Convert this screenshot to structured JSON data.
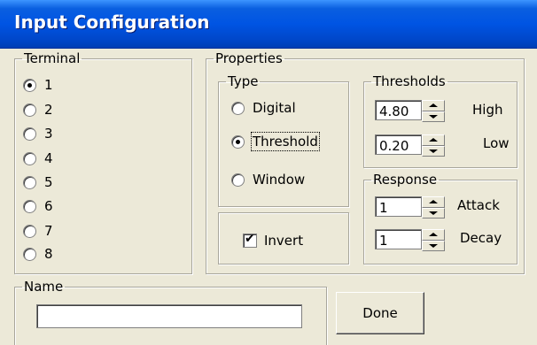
{
  "window": {
    "title": "Input Configuration"
  },
  "terminal": {
    "legend": "Terminal",
    "options": [
      "1",
      "2",
      "3",
      "4",
      "5",
      "6",
      "7",
      "8"
    ],
    "selected": "1"
  },
  "properties": {
    "legend": "Properties",
    "type": {
      "legend": "Type",
      "options": [
        "Digital",
        "Threshold",
        "Window"
      ],
      "selected": "Threshold"
    },
    "invert": {
      "label": "Invert",
      "checked": true
    },
    "thresholds": {
      "legend": "Thresholds",
      "high": {
        "value": "4.80",
        "label": "High"
      },
      "low": {
        "value": "0.20",
        "label": "Low"
      }
    },
    "response": {
      "legend": "Response",
      "attack": {
        "value": "1",
        "label": "Attack"
      },
      "decay": {
        "value": "1",
        "label": "Decay"
      }
    }
  },
  "name": {
    "legend": "Name",
    "value": ""
  },
  "done_label": "Done"
}
